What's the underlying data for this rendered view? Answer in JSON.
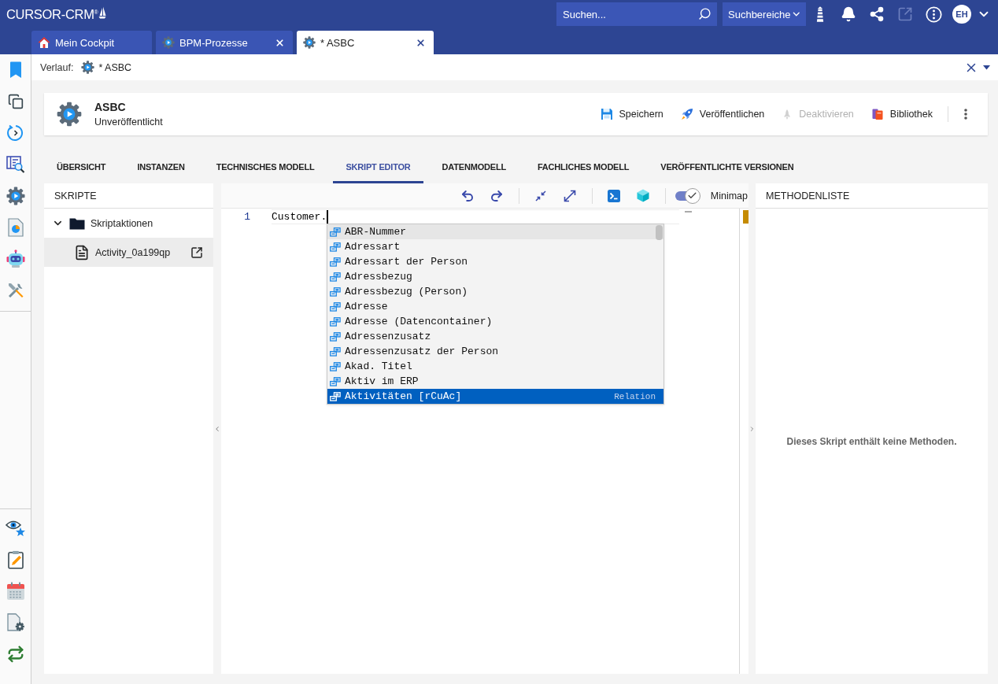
{
  "topbar": {
    "logo": "CURSOR-CRM$^{®}$",
    "search": {
      "placeholder": "Suchen..."
    },
    "search_scope": {
      "label": "Suchbereiche"
    },
    "open_external": {
      "disabled": true
    },
    "user": {
      "initials": "EH"
    }
  },
  "tabs": [
    {
      "label": "Mein Cockpit",
      "kind": "home",
      "selected": false,
      "closable": false
    },
    {
      "label": "BPM-Prozesse",
      "kind": "process",
      "selected": false,
      "closable": true
    },
    {
      "label": "* ASBC",
      "kind": "process",
      "selected": true,
      "closable": true
    }
  ],
  "breadcrumb": {
    "label": "Verlauf:",
    "items": [
      {
        "label": "* ASBC"
      }
    ]
  },
  "record": {
    "title": "ASBC",
    "status": "Unveröffentlicht"
  },
  "actions": [
    {
      "label": "Speichern",
      "kind": "save",
      "disabled": false
    },
    {
      "label": "Veröffentlichen",
      "kind": "publish",
      "disabled": false
    },
    {
      "label": "Deaktivieren",
      "kind": "deactivate",
      "disabled": true
    },
    {
      "label": "Bibliothek",
      "kind": "library",
      "disabled": false
    }
  ],
  "section_tabs": [
    {
      "label": "ÜBERSICHT",
      "selected": false
    },
    {
      "label": "INSTANZEN",
      "selected": false
    },
    {
      "label": "TECHNISCHES MODELL",
      "selected": false
    },
    {
      "label": "SKRIPT EDITOR",
      "selected": true
    },
    {
      "label": "DATENMODELL",
      "selected": false
    },
    {
      "label": "FACHLICHES MODELL",
      "selected": false
    },
    {
      "label": "VERÖFFENTLICHTE VERSIONEN",
      "selected": false
    }
  ],
  "scripts_panel": {
    "title": "SKRIPTE",
    "tree": [
      {
        "label": "Skriptaktionen",
        "expanded": true,
        "selected": false,
        "children": [
          {
            "label": "Activity_0a199qp",
            "selected": true
          }
        ]
      }
    ]
  },
  "editor": {
    "minimap": {
      "label": "Minimap",
      "on": true
    },
    "lines": [
      {
        "number": "1",
        "text": "Customer."
      }
    ],
    "suggestions": [
      {
        "label": "ABR-Nummer",
        "selected": false,
        "hovered": true
      },
      {
        "label": "Adressart",
        "selected": false,
        "hovered": false
      },
      {
        "label": "Adressart der Person",
        "selected": false,
        "hovered": false
      },
      {
        "label": "Adressbezug",
        "selected": false,
        "hovered": false
      },
      {
        "label": "Adressbezug (Person)",
        "selected": false,
        "hovered": false
      },
      {
        "label": "Adresse",
        "selected": false,
        "hovered": false
      },
      {
        "label": "Adresse (Datencontainer)",
        "selected": false,
        "hovered": false
      },
      {
        "label": "Adressenzusatz",
        "selected": false,
        "hovered": false
      },
      {
        "label": "Adressenzusatz der Person",
        "selected": false,
        "hovered": false
      },
      {
        "label": "Akad. Titel",
        "selected": false,
        "hovered": false
      },
      {
        "label": "Aktiv im ERP",
        "selected": false,
        "hovered": false
      },
      {
        "label": "Aktivitäten [rCuAc]",
        "selected": true,
        "hovered": false,
        "detail": "Relation"
      }
    ]
  },
  "methods_panel": {
    "title": "METHODENLISTE",
    "empty_message": "Dieses Skript enthält keine Methoden."
  }
}
